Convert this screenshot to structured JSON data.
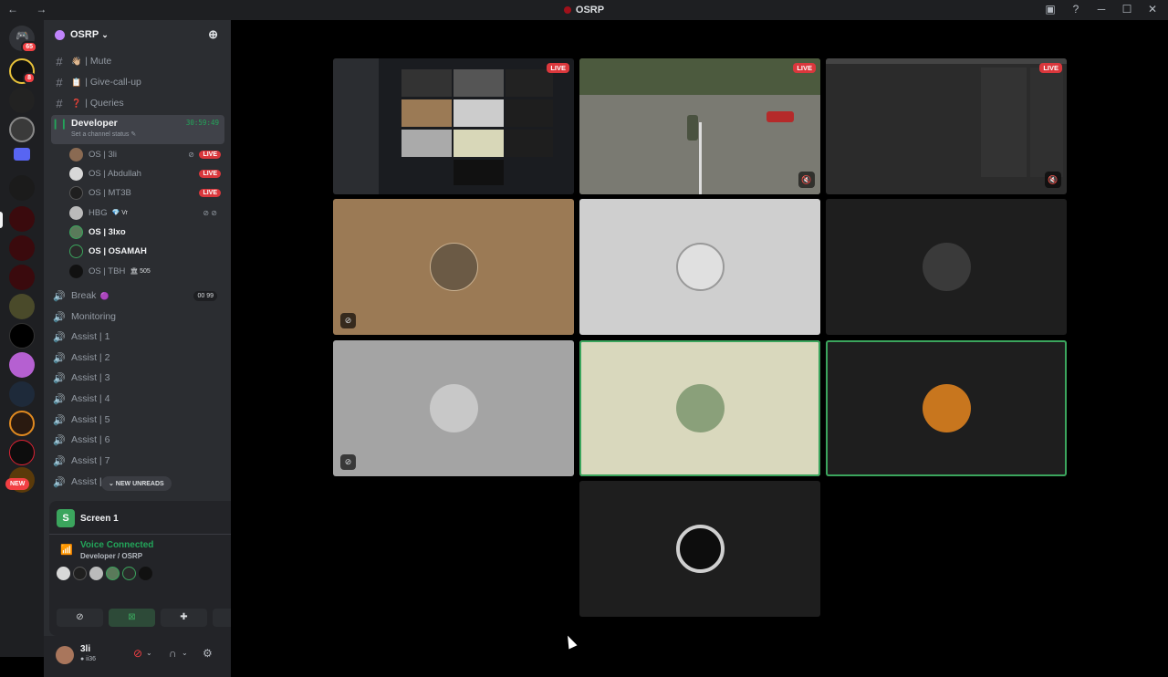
{
  "window": {
    "title": "OSRP",
    "nav": "← →"
  },
  "rail": {
    "dm_badge": "65",
    "server_badge": "8",
    "new_label": "NEW"
  },
  "server": {
    "name": "OSRP"
  },
  "channels": [
    {
      "type": "text",
      "emoji": "👋🏼",
      "label": "| Mute"
    },
    {
      "type": "text",
      "emoji": "📋",
      "label": "| Give-call-up"
    },
    {
      "type": "text",
      "emoji": "❓",
      "label": "| Queries"
    }
  ],
  "active_channel": {
    "label": "Developer",
    "status": "Set a channel status ✎",
    "timer": "30:59:49"
  },
  "voice_users": [
    {
      "name": "OS | 3li",
      "live": "LIVE",
      "muted": true,
      "color": "#8a6a52"
    },
    {
      "name": "OS | Abdullah",
      "live": "LIVE",
      "color": "#d8d8d8"
    },
    {
      "name": "OS | MT3B",
      "live": "LIVE",
      "color": "#1f1f1f"
    },
    {
      "name": "HBG",
      "tag": "💎 Vr",
      "icons": "⊘ ⊘",
      "color": "#bbbbbb"
    },
    {
      "name": "OS | 3lxo",
      "bold": true,
      "color": "#5a7a5a"
    },
    {
      "name": "OS | OSAMAH",
      "bold": true,
      "color": "#2a2a2a"
    },
    {
      "name": "OS | TBH",
      "tag": "🏛 505",
      "color": "#111111"
    }
  ],
  "voice_channels": [
    {
      "label": "Break",
      "emoji": "🟣",
      "counts": "00 99"
    },
    {
      "label": "Monitoring"
    },
    {
      "label": "Assist | 1"
    },
    {
      "label": "Assist | 2"
    },
    {
      "label": "Assist | 3"
    },
    {
      "label": "Assist | 4"
    },
    {
      "label": "Assist | 5"
    },
    {
      "label": "Assist | 6"
    },
    {
      "label": "Assist | 7"
    },
    {
      "label": "Assist |"
    }
  ],
  "new_unreads": "⌄ NEW UNREADS",
  "screen_share": {
    "label": "Screen 1"
  },
  "voice_connection": {
    "title": "Voice Connected",
    "subtitle": "Developer / OSRP"
  },
  "user": {
    "name": "3li",
    "status": "● ii36"
  },
  "tiles": [
    {
      "name": "screen-share-tile-1",
      "live": "LIVE",
      "bg": "#2a2d33"
    },
    {
      "name": "screen-share-tile-2",
      "live": "LIVE",
      "bg": "#6b6a5e"
    },
    {
      "name": "screen-share-tile-3",
      "live": "LIVE",
      "bg": "#2b2b2b"
    }
  ],
  "colors": {
    "accent_green": "#3ba55d",
    "live_red": "#da373c",
    "sidebar": "#2b2d31",
    "rail": "#1e1f22"
  }
}
